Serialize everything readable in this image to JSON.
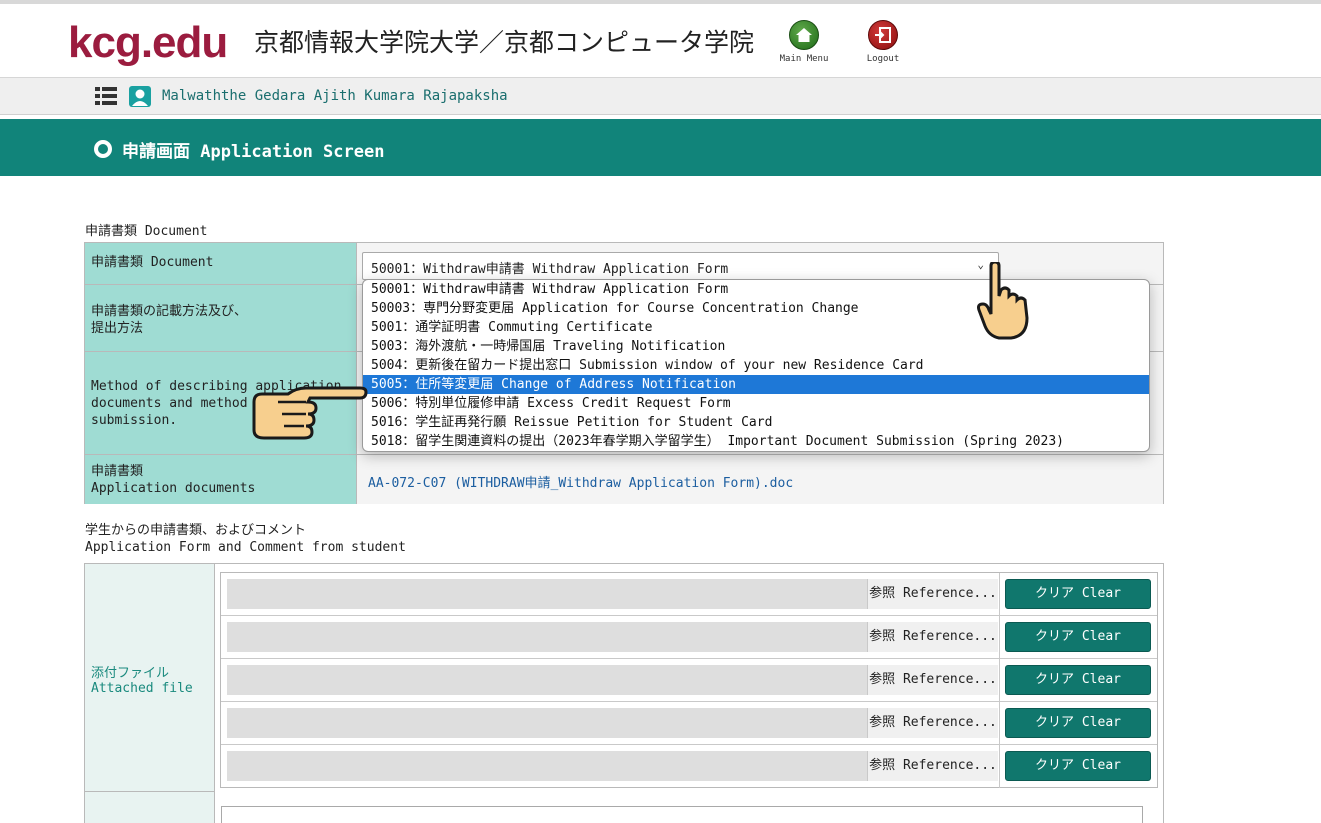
{
  "header": {
    "logo_text": "kcg.edu",
    "school_name": "京都情報大学院大学／京都コンピュータ学院",
    "main_menu_label": "Main Menu",
    "logout_label": "Logout",
    "brand_color": "#9b1c3f"
  },
  "userbar": {
    "user_name": "Malwaththe Gedara Ajith Kumara Rajapaksha"
  },
  "titlebar": {
    "title": "申請画面 Application Screen",
    "color": "#11847a"
  },
  "document_section": {
    "label": "申請書類 Document",
    "rows": [
      {
        "label": "申請書類 Document"
      },
      {
        "label_line1": "申請書類の記載方法及び、",
        "label_line2": "提出方法"
      },
      {
        "label_line1": "Method of describing application",
        "label_line2": "documents and method of",
        "label_line3": "submission."
      },
      {
        "label_line1": "申請書類",
        "label_line2": "Application documents"
      }
    ],
    "selected_value": "50001：Withdraw申請書 Withdraw Application Form",
    "document_link": "AA-072-C07 (WITHDRAW申請_Withdraw Application Form).doc",
    "dropdown_options": [
      "50001：Withdraw申請書 Withdraw Application Form",
      "50003：専門分野変更届 Application for Course Concentration Change",
      "5001：通学証明書 Commuting Certificate",
      "5003：海外渡航・一時帰国届 Traveling Notification",
      "5004：更新後在留カード提出窓口 Submission window of your new Residence Card",
      "5005：住所等変更届 Change of Address Notification",
      "5006：特別単位履修申請 Excess Credit Request Form",
      "5016：学生証再発行願 Reissue Petition for Student Card",
      "5018：留学生関連資料の提出（2023年春学期入学留学生） Important Document Submission (Spring 2023)"
    ],
    "highlighted_option_index": 5
  },
  "attach_section": {
    "label_line1": "学生からの申請書類、およびコメント",
    "label_line2": "Application Form and Comment from student",
    "attached_label_jp": "添付ファイル",
    "attached_label_en": "Attached file",
    "reference_label": "参照 Reference...",
    "clear_label": "クリア Clear",
    "file_rows": 5
  }
}
